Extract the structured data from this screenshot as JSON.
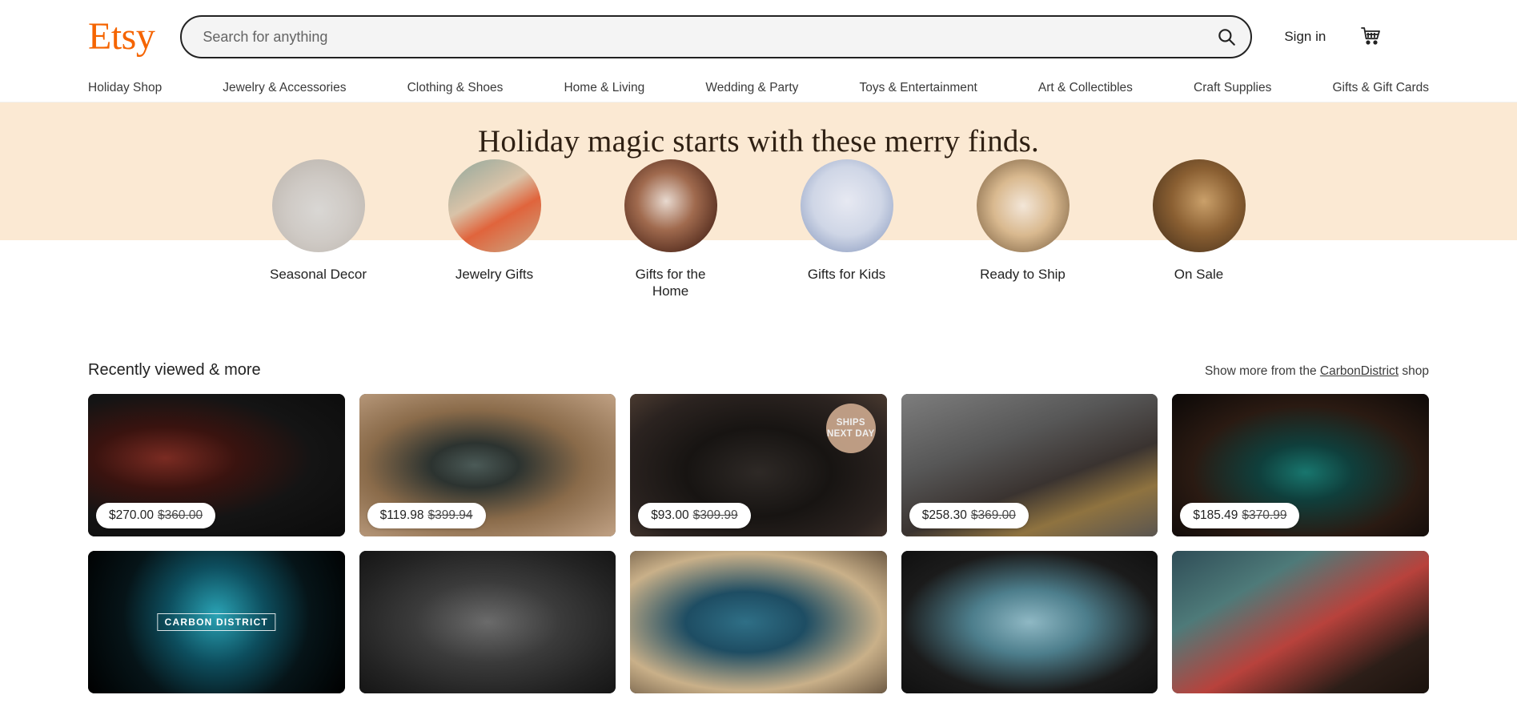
{
  "header": {
    "logo_text": "Etsy",
    "logo_color": "#F56400",
    "search": {
      "placeholder": "Search for anything",
      "value": "",
      "icon": "search-icon"
    },
    "sign_in_label": "Sign in",
    "cart_icon": "shopping-cart-icon"
  },
  "category_nav": {
    "items": [
      {
        "label": "Holiday Shop"
      },
      {
        "label": "Jewelry & Accessories"
      },
      {
        "label": "Clothing & Shoes"
      },
      {
        "label": "Home & Living"
      },
      {
        "label": "Wedding & Party"
      },
      {
        "label": "Toys & Entertainment"
      },
      {
        "label": "Art & Collectibles"
      },
      {
        "label": "Craft Supplies"
      },
      {
        "label": "Gifts & Gift Cards"
      }
    ]
  },
  "hero": {
    "title": "Holiday magic starts with these merry finds.",
    "background_color": "#fbe9d3",
    "circles": [
      {
        "label": "Seasonal Decor",
        "image": "hanging-stockings-photo"
      },
      {
        "label": "Jewelry Gifts",
        "image": "orange-jewelry-box-photo"
      },
      {
        "label": "Gifts for the Home",
        "image": "glass-ornament-photo"
      },
      {
        "label": "Gifts for Kids",
        "image": "child-with-pillow-photo"
      },
      {
        "label": "Ready to Ship",
        "image": "hand-holding-jars-photo"
      },
      {
        "label": "On Sale",
        "image": "poodle-dog-photo"
      }
    ]
  },
  "recently_viewed": {
    "title": "Recently viewed & more",
    "show_more_prefix": "Show more from the ",
    "shop_name": "CarbonDistrict",
    "show_more_suffix": " shop",
    "items": [
      {
        "image": "red-wood-black-rings-photo",
        "image_class": "img-rings-dark",
        "price": "$270.00",
        "original_price": "$360.00",
        "badge": null
      },
      {
        "image": "opal-inlay-ring-on-stone-photo",
        "image_class": "img-ring-opal",
        "price": "$119.98",
        "original_price": "$399.94",
        "badge": null
      },
      {
        "image": "black-rings-with-stones-photo",
        "image_class": "img-ring-blk",
        "price": "$93.00",
        "original_price": "$309.99",
        "badge": "SHIPS NEXT DAY"
      },
      {
        "image": "forged-carbon-gold-ring-photo",
        "image_class": "img-ring-gold",
        "price": "$258.30",
        "original_price": "$369.00",
        "badge": null
      },
      {
        "image": "wood-turquoise-rings-photo",
        "image_class": "img-ring-teal",
        "price": "$185.49",
        "original_price": "$370.99",
        "badge": null
      },
      {
        "image": "carbon-district-shop-logo",
        "image_class": "img-logo",
        "logo_text": "CARBON DISTRICT",
        "price": null,
        "original_price": null,
        "badge": null
      },
      {
        "image": "pair-of-black-rings-photo",
        "image_class": "img-rings-pair",
        "price": null,
        "original_price": null,
        "badge": null
      },
      {
        "image": "blue-gold-ring-photo",
        "image_class": "img-ring-blue",
        "price": null,
        "original_price": null,
        "badge": null
      },
      {
        "image": "dark-blue-ring-photo",
        "image_class": "img-ring-blue2",
        "price": null,
        "original_price": null,
        "badge": null
      },
      {
        "image": "ring-on-books-photo",
        "image_class": "img-ring-books",
        "price": null,
        "original_price": null,
        "badge": null
      }
    ]
  }
}
